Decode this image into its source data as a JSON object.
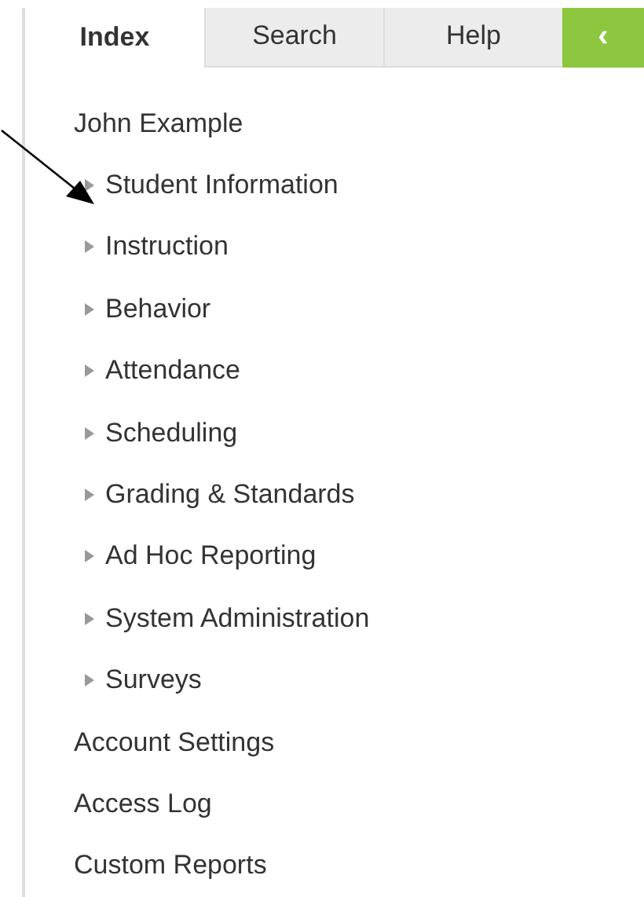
{
  "tabs": [
    {
      "label": "Index",
      "selected": true
    },
    {
      "label": "Search",
      "selected": false
    },
    {
      "label": "Help",
      "selected": false
    }
  ],
  "collapse_button": {
    "label": "‹"
  },
  "items": [
    {
      "label": "John Example",
      "kind": "link"
    },
    {
      "label": "Student Information",
      "kind": "folder"
    },
    {
      "label": "Instruction",
      "kind": "folder"
    },
    {
      "label": "Behavior",
      "kind": "folder"
    },
    {
      "label": "Attendance",
      "kind": "folder"
    },
    {
      "label": "Scheduling",
      "kind": "folder"
    },
    {
      "label": "Grading & Standards",
      "kind": "folder"
    },
    {
      "label": "Ad Hoc Reporting",
      "kind": "folder"
    },
    {
      "label": "System Administration",
      "kind": "folder"
    },
    {
      "label": "Surveys",
      "kind": "folder"
    },
    {
      "label": "Account Settings",
      "kind": "link"
    },
    {
      "label": "Access Log",
      "kind": "link"
    },
    {
      "label": "Custom Reports",
      "kind": "link"
    }
  ]
}
